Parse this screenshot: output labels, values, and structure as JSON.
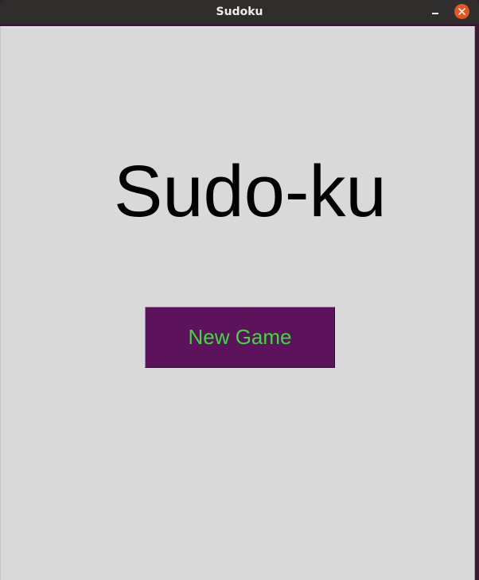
{
  "window": {
    "title": "Sudoku",
    "minimize_icon": "minimize-icon",
    "close_icon": "close-icon",
    "close_color": "#e95420"
  },
  "main": {
    "heading": "Sudo-ku",
    "new_game_label": "New Game",
    "button_bg": "#5c135c",
    "button_text_color": "#3ddc3d",
    "background": "#d9d9d9"
  }
}
